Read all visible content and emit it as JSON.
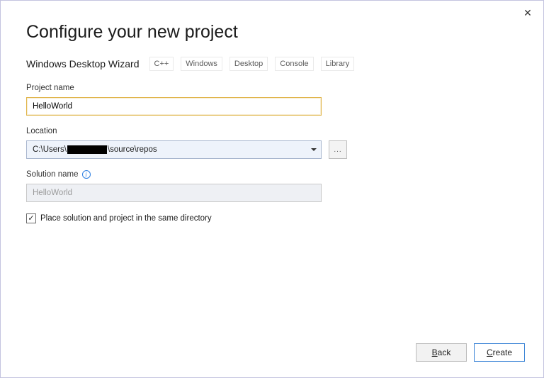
{
  "title": "Configure your new project",
  "subhead": "Windows Desktop Wizard",
  "tags": [
    "C++",
    "Windows",
    "Desktop",
    "Console",
    "Library"
  ],
  "projectName": {
    "label": "Project name",
    "value": "HelloWorld"
  },
  "location": {
    "label": "Location",
    "prefix": "C:\\Users\\",
    "suffix": "\\source\\repos",
    "browse": "..."
  },
  "solutionName": {
    "label": "Solution name",
    "placeholder": "HelloWorld"
  },
  "sameDir": {
    "label": "Place solution and project in the same directory",
    "checked": true
  },
  "buttons": {
    "back": "Back",
    "create": "Create"
  }
}
